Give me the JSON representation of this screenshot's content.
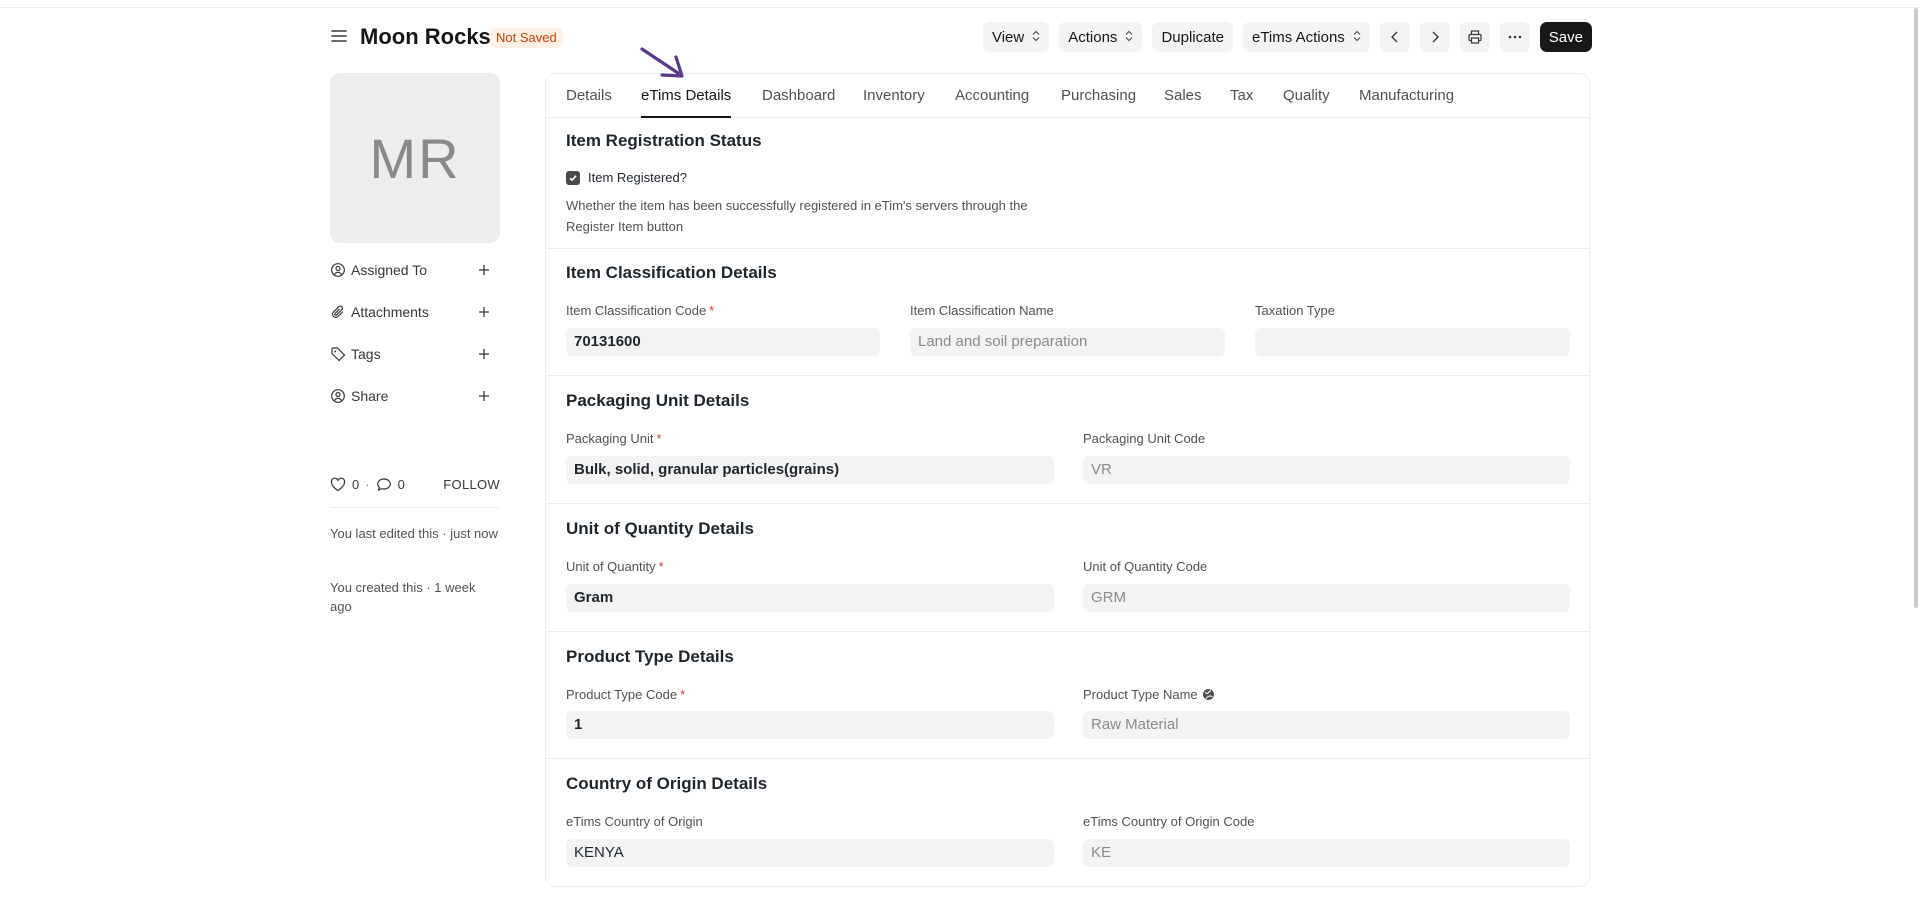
{
  "header": {
    "title": "Moon Rocks",
    "status": "Not Saved",
    "buttons": {
      "view": "View",
      "actions": "Actions",
      "duplicate": "Duplicate",
      "etims_actions": "eTims Actions",
      "save": "Save"
    }
  },
  "sidebar": {
    "avatar_initials": "MR",
    "items": [
      {
        "label": "Assigned To"
      },
      {
        "label": "Attachments"
      },
      {
        "label": "Tags"
      },
      {
        "label": "Share"
      }
    ],
    "likes": "0",
    "comments": "0",
    "follow": "FOLLOW",
    "timeline": [
      "You last edited this · just now",
      "You created this · 1 week ago"
    ]
  },
  "tabs": [
    {
      "label": "Details"
    },
    {
      "label": "eTims Details"
    },
    {
      "label": "Dashboard"
    },
    {
      "label": "Inventory"
    },
    {
      "label": "Accounting"
    },
    {
      "label": "Purchasing"
    },
    {
      "label": "Sales"
    },
    {
      "label": "Tax"
    },
    {
      "label": "Quality"
    },
    {
      "label": "Manufacturing"
    }
  ],
  "sections": {
    "registration": {
      "title": "Item Registration Status",
      "checkbox_label": "Item Registered?",
      "checked": true,
      "description": "Whether the item has been successfully registered in eTim's servers through the Register Item button"
    },
    "classification": {
      "title": "Item Classification Details",
      "code_label": "Item Classification Code",
      "code_value": "70131600",
      "name_label": "Item Classification Name",
      "name_value": "Land and soil preparation",
      "taxation_label": "Taxation Type",
      "taxation_value": ""
    },
    "packaging": {
      "title": "Packaging Unit Details",
      "unit_label": "Packaging Unit",
      "unit_value": "Bulk, solid, granular particles(grains)",
      "code_label": "Packaging Unit Code",
      "code_value": "VR"
    },
    "uoq": {
      "title": "Unit of Quantity Details",
      "unit_label": "Unit of Quantity",
      "unit_value": "Gram",
      "code_label": "Unit of Quantity Code",
      "code_value": "GRM"
    },
    "product_type": {
      "title": "Product Type Details",
      "code_label": "Product Type Code",
      "code_value": "1",
      "name_label": "Product Type Name",
      "name_value": "Raw Material"
    },
    "origin": {
      "title": "Country of Origin Details",
      "country_label": "eTims Country of Origin",
      "country_value": "KENYA",
      "code_label": "eTims Country of Origin Code",
      "code_value": "KE"
    }
  },
  "required_marker": "*",
  "colors": {
    "primary": "#171717",
    "status_bg": "#fff0e6",
    "status_text": "#c2410c",
    "required": "#e03636",
    "arrow": "#5b3a8c"
  }
}
